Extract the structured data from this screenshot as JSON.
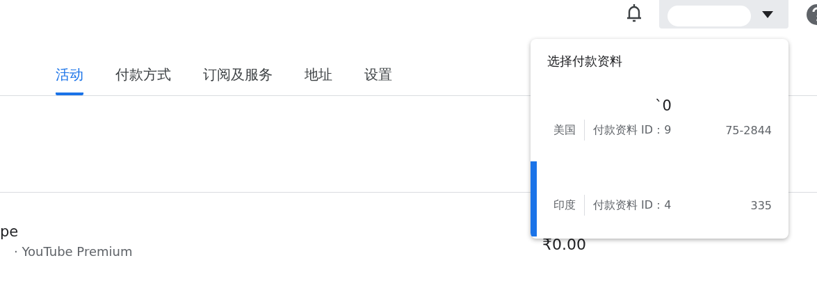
{
  "tabs": [
    {
      "label": "活动",
      "selected": true
    },
    {
      "label": "付款方式",
      "selected": false
    },
    {
      "label": "订阅及服务",
      "selected": false
    },
    {
      "label": "地址",
      "selected": false
    },
    {
      "label": "设置",
      "selected": false
    }
  ],
  "transaction": {
    "title": "pe",
    "subtitle": "· YouTube Premium",
    "amount": "₹0.00"
  },
  "profile_menu": {
    "title": "选择付款资料",
    "profiles": [
      {
        "name": "`0",
        "country": "美国",
        "id_start": "付款资料 ID：9",
        "id_end": "75-2844",
        "selected": false
      },
      {
        "country": "印度",
        "id_start": "付款资料 ID：4",
        "id_end": "335",
        "selected": true
      }
    ]
  }
}
